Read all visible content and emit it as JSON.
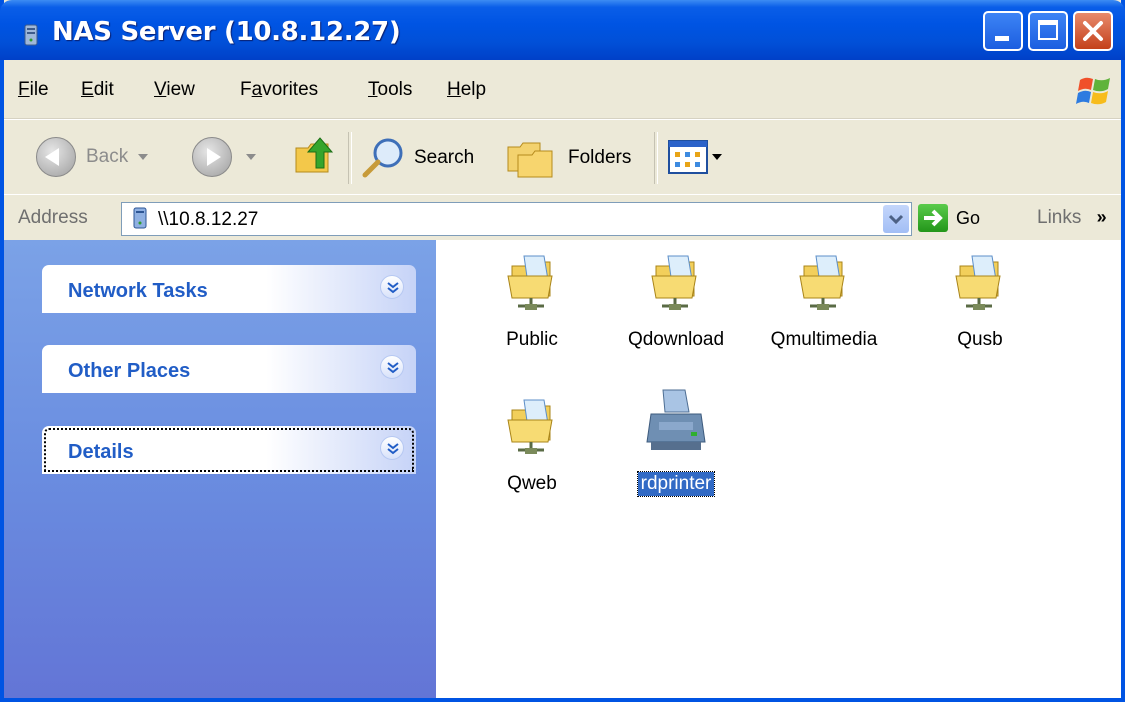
{
  "window": {
    "title": "NAS Server (10.8.12.27)"
  },
  "menu": [
    {
      "label": "File",
      "accel": "F",
      "rest": "ile"
    },
    {
      "label": "Edit",
      "accel": "E",
      "rest": "dit"
    },
    {
      "label": "View",
      "accel": "V",
      "rest": "iew"
    },
    {
      "label": "Favorites",
      "pre": "F",
      "accel": "a",
      "rest": "vorites"
    },
    {
      "label": "Tools",
      "accel": "T",
      "rest": "ools"
    },
    {
      "label": "Help",
      "accel": "H",
      "rest": "elp"
    }
  ],
  "toolbar": {
    "back_label": "Back",
    "search_label": "Search",
    "folders_label": "Folders"
  },
  "address": {
    "label": "Address",
    "value": "\\\\10.8.12.27",
    "go_label": "Go",
    "links_label": "Links",
    "links_chevron": "»"
  },
  "taskpane": {
    "panels": [
      {
        "title": "Network Tasks"
      },
      {
        "title": "Other Places"
      },
      {
        "title": "Details"
      }
    ]
  },
  "items": [
    {
      "label": "Public",
      "type": "shared-folder"
    },
    {
      "label": "Qdownload",
      "type": "shared-folder"
    },
    {
      "label": "Qmultimedia",
      "type": "shared-folder"
    },
    {
      "label": "Qusb",
      "type": "shared-folder"
    },
    {
      "label": "Qweb",
      "type": "shared-folder"
    },
    {
      "label": "rdprinter",
      "type": "printer",
      "selected": true
    }
  ],
  "colors": {
    "titlebar": "#0054E3",
    "taskpane_top": "#7BA2E7",
    "taskpane_bottom": "#6375D6",
    "panel_title": "#215DC6",
    "selection": "#316AC5"
  }
}
